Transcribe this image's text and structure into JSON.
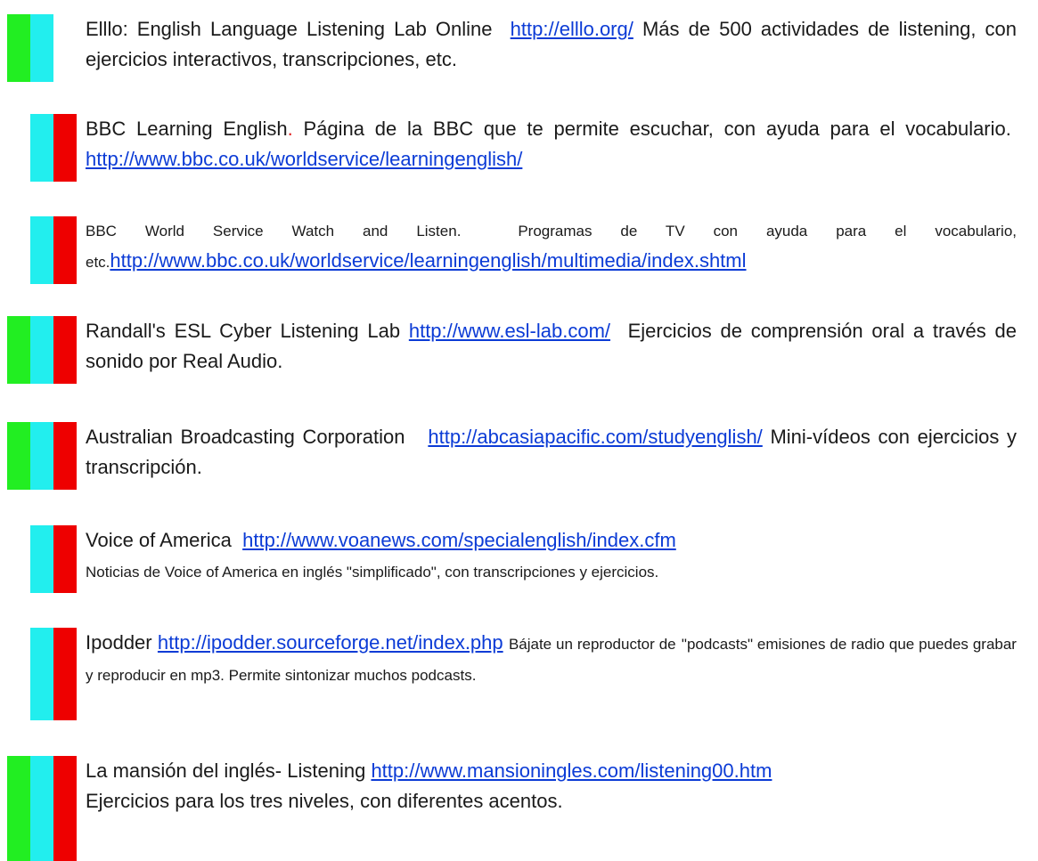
{
  "colors": {
    "green": "#22ee22",
    "cyan": "#22eeee",
    "red": "#ee0000",
    "link": "#0b3bd6"
  },
  "entries": [
    {
      "bars": [
        "green",
        "cyan"
      ],
      "title": "Elllo: English Language Listening Lab Online",
      "url": "http://elllo.org/",
      "desc": "Más de 500 actividades de listening, con ejercicios interactivos, transcripciones, etc."
    },
    {
      "bars": [
        "cyan",
        "red"
      ],
      "title": "BBC Learning English",
      "dot": ".",
      "desc": "Página de la BBC que te permite escuchar, con ayuda para el vocabulario.",
      "url": "http://www.bbc.co.uk/worldservice/learningenglish/"
    },
    {
      "bars": [
        "cyan",
        "red"
      ],
      "title": "BBC World Service Watch and Listen.",
      "desc": "Programas de TV con ayuda para el vocabulario, etc.",
      "url": "http://www.bbc.co.uk/worldservice/learningenglish/multimedia/index.shtml"
    },
    {
      "bars": [
        "green",
        "cyan",
        "red"
      ],
      "title": "Randall's ESL Cyber Listening Lab",
      "url": "http://www.esl-lab.com/",
      "desc": "Ejercicios de comprensión oral a través de sonido por Real Audio."
    },
    {
      "bars": [
        "green",
        "cyan",
        "red"
      ],
      "title": "Australian Broadcasting Corporation",
      "url": "http://abcasiapacific.com/studyenglish/",
      "desc": "Mini-vídeos con ejercicios y transcripción."
    },
    {
      "bars": [
        "cyan",
        "red"
      ],
      "title": "Voice of America",
      "url": "http://www.voanews.com/specialenglish/index.cfm",
      "desc": "Noticias de Voice of America en inglés \"simplificado\", con transcripciones y ejercicios."
    },
    {
      "bars": [
        "cyan",
        "red"
      ],
      "title": "Ipodder",
      "url": "http://ipodder.sourceforge.net/index.php",
      "desc": "Bájate un reproductor de",
      "desc2": "\"podcasts\" emisiones de radio que puedes grabar y reproducir en mp3. Permite sintonizar muchos podcasts."
    },
    {
      "bars": [
        "green",
        "cyan",
        "red"
      ],
      "title": "La mansión del inglés- Listening",
      "url": "http://www.mansioningles.com/listening00.htm",
      "desc": "Ejercicios para los tres niveles, con diferentes acentos."
    }
  ]
}
